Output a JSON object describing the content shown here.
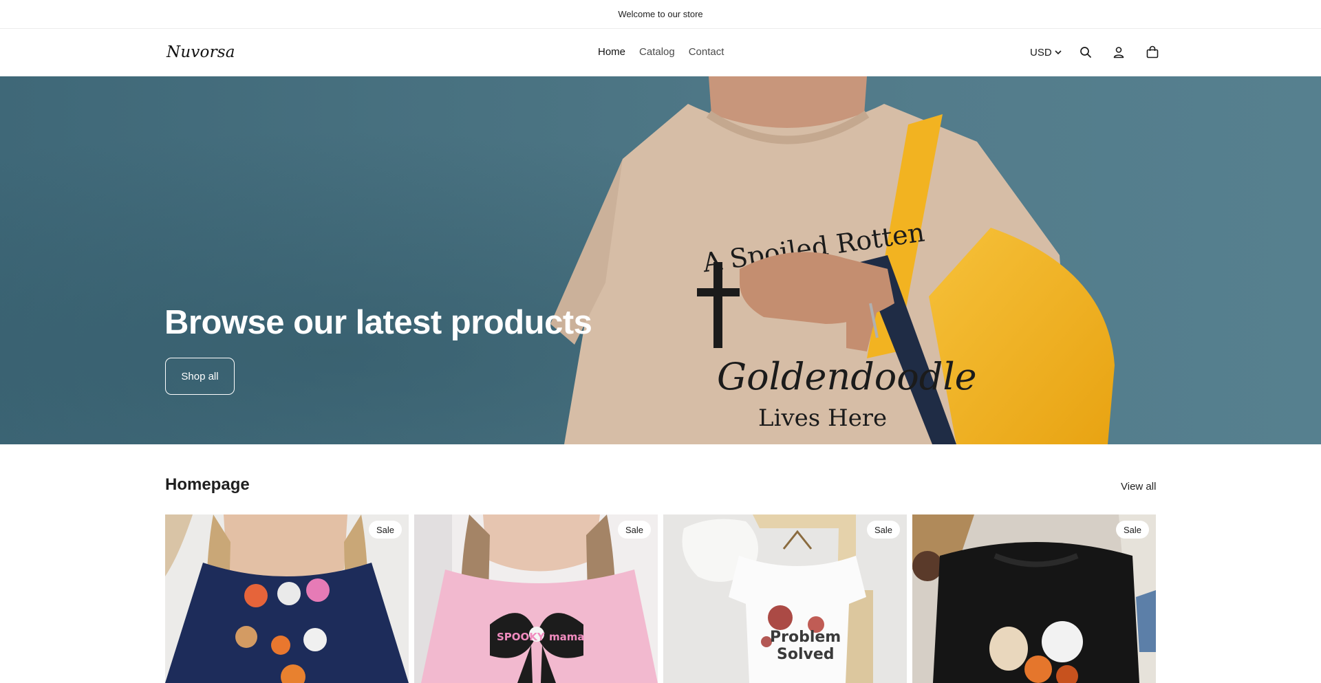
{
  "announcement": {
    "text": "Welcome to our store"
  },
  "header": {
    "logo": "Nuvorsa",
    "nav": [
      {
        "label": "Home",
        "active": true
      },
      {
        "label": "Catalog",
        "active": false
      },
      {
        "label": "Contact",
        "active": false
      }
    ],
    "currency": "USD",
    "icons": [
      "search-icon",
      "account-icon",
      "cart-icon"
    ]
  },
  "hero": {
    "title": "Browse our latest products",
    "button": "Shop all",
    "shirt_text": {
      "line1": "A Spoiled Rotten",
      "line2": "Goldendoodle",
      "line3": "Lives Here"
    }
  },
  "section": {
    "title": "Homepage",
    "view_all": "View all"
  },
  "products": [
    {
      "badge": "Sale"
    },
    {
      "badge": "Sale",
      "print_left": "SPOOKY",
      "print_right": "mama"
    },
    {
      "badge": "Sale",
      "print_line1": "Problem",
      "print_line2": "Solved"
    },
    {
      "badge": "Sale"
    }
  ],
  "colors": {
    "hero_bg": "#4d7685",
    "accent": "#f2b321"
  }
}
